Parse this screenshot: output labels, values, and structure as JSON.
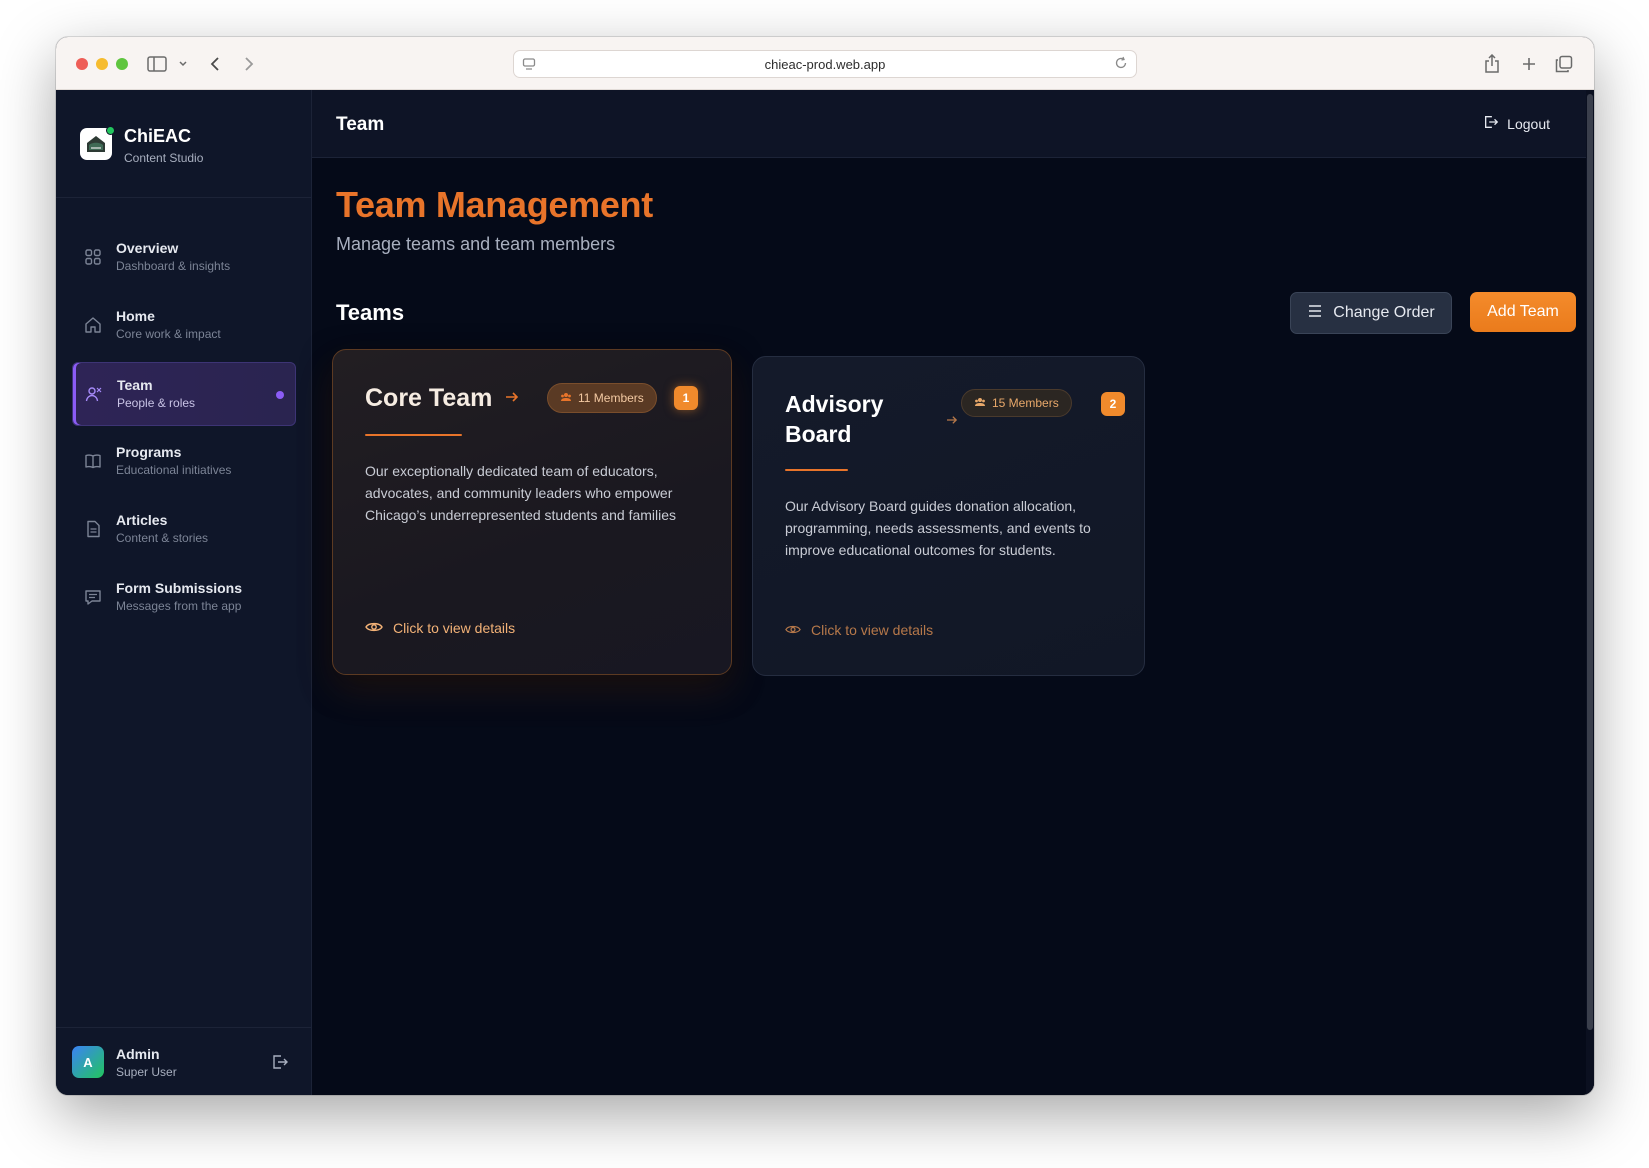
{
  "browser": {
    "url": "chieac-prod.web.app"
  },
  "sidebar": {
    "brand_name": "ChiEAC",
    "brand_sub": "Content Studio",
    "items": [
      {
        "label": "Overview",
        "sub": "Dashboard & insights",
        "icon": "grid-icon",
        "active": false
      },
      {
        "label": "Home",
        "sub": "Core work & impact",
        "icon": "home-icon",
        "active": false
      },
      {
        "label": "Team",
        "sub": "People & roles",
        "icon": "team-icon",
        "active": true
      },
      {
        "label": "Programs",
        "sub": "Educational initiatives",
        "icon": "book-icon",
        "active": false
      },
      {
        "label": "Articles",
        "sub": "Content & stories",
        "icon": "document-icon",
        "active": false
      },
      {
        "label": "Form Submissions",
        "sub": "Messages from the app",
        "icon": "message-icon",
        "active": false
      }
    ],
    "user": {
      "initial": "A",
      "name": "Admin",
      "role": "Super User"
    }
  },
  "topbar": {
    "title": "Team",
    "logout_label": "Logout"
  },
  "main": {
    "page_title": "Team Management",
    "page_sub": "Manage teams and team members",
    "section_title": "Teams",
    "change_order_label": "Change Order",
    "add_team_label": "Add Team"
  },
  "teams": [
    {
      "name": "Core Team",
      "members": "11 Members",
      "order": "1",
      "description": "Our exceptionally dedicated team of educators, advocates, and community leaders who empower Chicago’s underrepresented students and families",
      "link": "Click to view details"
    },
    {
      "name": "Advisory Board",
      "members": "15 Members",
      "order": "2",
      "description": "Our Advisory Board guides donation allocation, programming, needs assessments, and events to improve educational outcomes for students.",
      "link": "Click to view details"
    }
  ],
  "colors": {
    "accent": "#e8742a",
    "active_nav": "#8b5cf6",
    "background": "#050a18"
  }
}
